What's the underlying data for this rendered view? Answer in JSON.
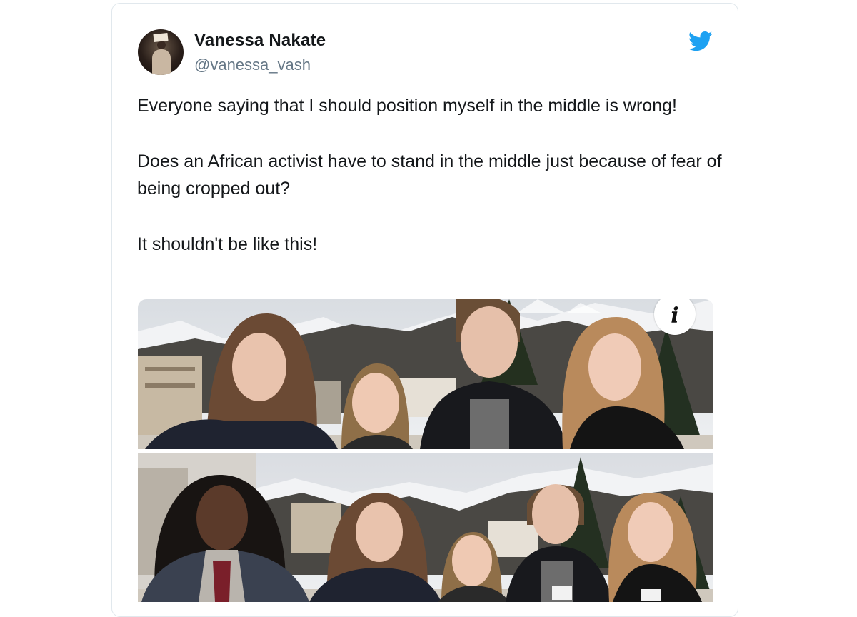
{
  "tweet": {
    "author_name": "Vanessa Nakate",
    "author_handle": "@vanessa_vash",
    "paragraphs": [
      "Everyone saying that I should position myself in the middle is wrong!",
      "Does an African activist have to stand in the middle just because of fear of being cropped out?",
      "It shouldn't be like this!"
    ],
    "info_icon_glyph": "i"
  },
  "icons": {
    "brand": "twitter-bird-icon",
    "info": "info-icon"
  },
  "colors": {
    "brand_blue": "#1da1f2",
    "text_primary": "#14171a",
    "text_secondary": "#657786",
    "card_border": "#e1e8ed"
  }
}
